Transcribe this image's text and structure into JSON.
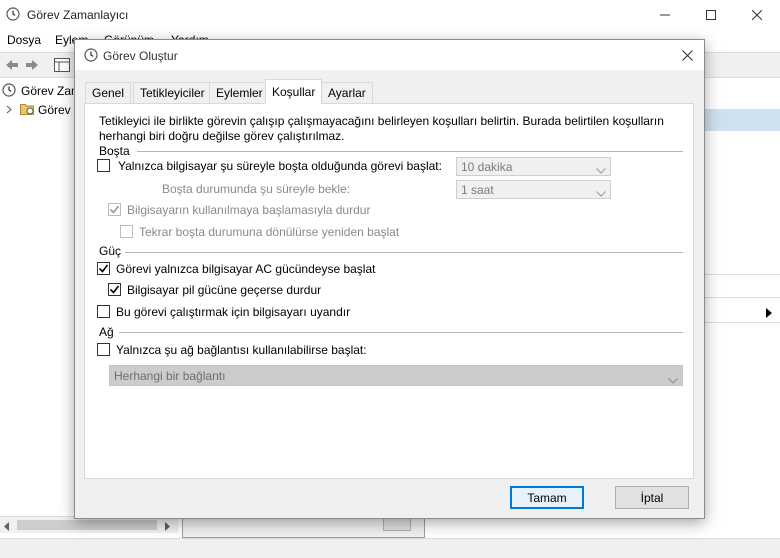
{
  "main_window": {
    "title": "Görev Zamanlayıcı",
    "menu": [
      "Dosya",
      "Eylem",
      "Görünüm",
      "Yardım"
    ],
    "tree_root": "Görev Zamanla",
    "tree_child": "Görev"
  },
  "dialog": {
    "title": "Görev Oluştur",
    "tabs": [
      "Genel",
      "Tetikleyiciler",
      "Eylemler",
      "Koşullar",
      "Ayarlar"
    ],
    "active_tab": "Koşullar",
    "description": [
      "Tetikleyici ile birlikte görevin çalışıp çalışmayacağını belirleyen koşulları belirtin. Burada belirtilen koşulların",
      "herhangi biri doğru değilse görev çalıştırılmaz."
    ],
    "idle": {
      "section_label": "Boşta",
      "start_only_idle": {
        "label": "Yalnızca bilgisayar şu süreyle boşta olduğunda görevi başlat:",
        "checked": false
      },
      "idle_duration": {
        "value": "10 dakika"
      },
      "wait_label": "Boşta durumunda şu süreyle bekle:",
      "wait_duration": {
        "value": "1 saat"
      },
      "stop_on_active": {
        "label": "Bilgisayarın kullanılmaya başlamasıyla durdur",
        "checked": true,
        "enabled": false
      },
      "restart_on_idle": {
        "label": "Tekrar boşta durumuna dönülürse yeniden başlat",
        "checked": false,
        "enabled": false
      }
    },
    "power": {
      "section_label": "Güç",
      "ac_only": {
        "label": "Görevi yalnızca bilgisayar AC gücündeyse başlat",
        "checked": true
      },
      "stop_on_battery": {
        "label": "Bilgisayar pil gücüne geçerse durdur",
        "checked": true
      },
      "wake_to_run": {
        "label": "Bu görevi çalıştırmak için bilgisayarı uyandır",
        "checked": false
      }
    },
    "network": {
      "section_label": "Ağ",
      "only_if_network": {
        "label": "Yalnızca şu ağ bağlantısı kullanılabilirse başlat:",
        "checked": false
      },
      "connection": {
        "value": "Herhangi bir bağlantı"
      }
    },
    "ok_label": "Tamam",
    "cancel_label": "İptal"
  },
  "colors": {
    "accent": "#0078d7",
    "dialog_bg": "#f0f0f0",
    "selection": "#cfe0f0"
  }
}
